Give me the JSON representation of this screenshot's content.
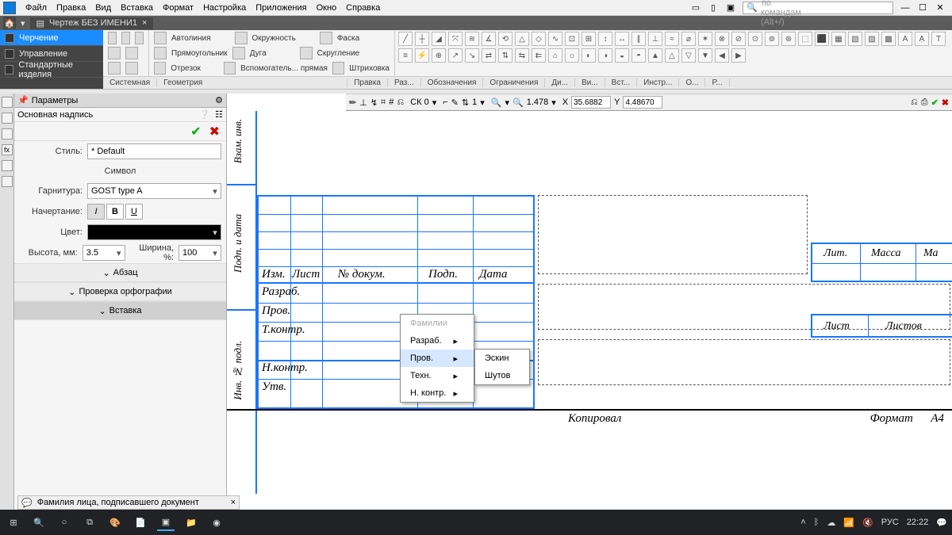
{
  "menu": {
    "items": [
      "Файл",
      "Правка",
      "Вид",
      "Вставка",
      "Формат",
      "Настройка",
      "Приложения",
      "Окно",
      "Справка"
    ]
  },
  "search_placeholder": "Поиск по командам (Alt+/)",
  "doc_tab": "Чертеж БЕЗ ИМЕНИ1",
  "left_tabs": {
    "items": [
      "Черчение",
      "Управление",
      "Стандартные изделия"
    ]
  },
  "ribbon": {
    "row1": [
      "Автолиния",
      "Окружность",
      "Фаска"
    ],
    "row2": [
      "Прямоугольник",
      "Дуга",
      "Скругление"
    ],
    "row3": [
      "Отрезок",
      "Вспомогатель... прямая",
      "Штриховка"
    ],
    "captions": [
      "Системная",
      "Геометрия",
      "Правка",
      "Раз...",
      "Обозначения",
      "Ограничения",
      "Ди...",
      "Ви...",
      "Вст...",
      "Инстр...",
      "О...",
      "Р..."
    ]
  },
  "ctx": {
    "sk": "СК 0",
    "step": "1",
    "zoom": "1.478",
    "x_label": "X",
    "x_val": "35.6882",
    "y_label": "Y",
    "y_val": "4.48670"
  },
  "params": {
    "title": "Параметры",
    "sub": "Основная надпись",
    "style_label": "Стиль:",
    "style_value": "* Default",
    "symbol_title": "Символ",
    "font_label": "Гарнитура:",
    "font_value": "GOST type A",
    "weight_label": "Начертание:",
    "italic": "I",
    "bold": "B",
    "under": "U",
    "color_label": "Цвет:",
    "height_label": "Высота, мм:",
    "height_value": "3.5",
    "width_label": "Ширина, %:",
    "width_value": "100",
    "sections": [
      "Абзац",
      "Проверка орфографии",
      "Вставка"
    ]
  },
  "hint": "Фамилия лица, подписавшего документ",
  "side_labels": {
    "top": "Взам. инв.",
    "mid": "Подп. и дата",
    "bot": "Инв. № подл."
  },
  "tb_cells": {
    "row_headers": [
      "Изм.",
      "Лист",
      "№ докум.",
      "Подп.",
      "Дата"
    ],
    "roles": [
      "Разраб.",
      "Пров.",
      "Т.контр.",
      "",
      "Н.контр.",
      "Утв."
    ],
    "right_top": [
      "Лит.",
      "Масса",
      "Ма"
    ],
    "right_bot": [
      "Лист",
      "Листов"
    ],
    "footer_left": "Копировал",
    "footer_right": "Формат      А4"
  },
  "menu1": {
    "title": "Фамилии",
    "items": [
      "Разраб.",
      "Пров.",
      "Техн.",
      "Н. контр."
    ]
  },
  "menu2": {
    "items": [
      "Эскин",
      "Шутов"
    ]
  },
  "taskbar": {
    "lang": "РУС",
    "time": "22:22"
  }
}
